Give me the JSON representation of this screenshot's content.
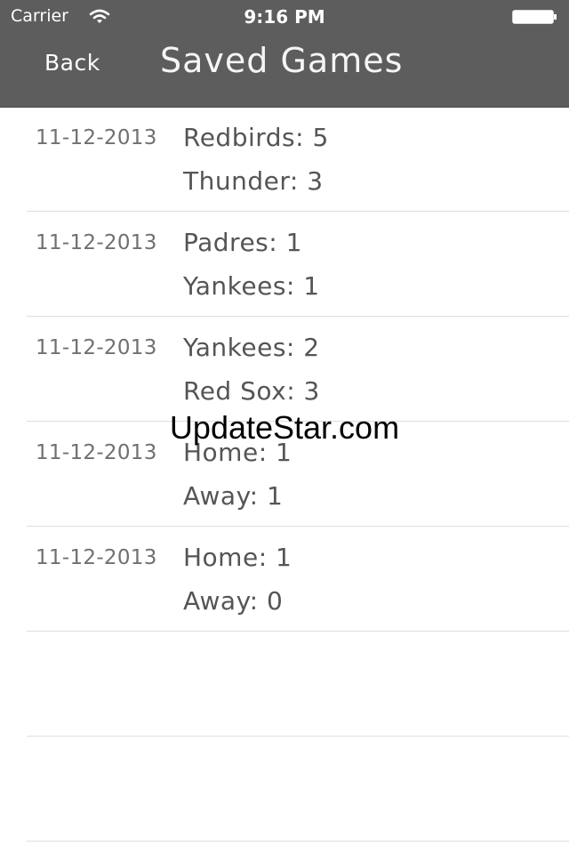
{
  "status_bar": {
    "carrier": "Carrier",
    "time": "9:16 PM",
    "wifi_icon": "wifi-icon",
    "battery_icon": "battery-icon"
  },
  "nav": {
    "back_label": "Back",
    "title": "Saved Games"
  },
  "games": [
    {
      "date": "11-12-2013",
      "line1": "Redbirds: 5",
      "line2": "Thunder: 3"
    },
    {
      "date": "11-12-2013",
      "line1": "Padres: 1",
      "line2": "Yankees: 1"
    },
    {
      "date": "11-12-2013",
      "line1": "Yankees: 2",
      "line2": "Red Sox: 3"
    },
    {
      "date": "11-12-2013",
      "line1": "Home: 1",
      "line2": "Away: 1"
    },
    {
      "date": "11-12-2013",
      "line1": "Home: 1",
      "line2": "Away: 0"
    }
  ],
  "empty_rows": 2,
  "watermark": "UpdateStar.com",
  "colors": {
    "nav_background": "#5d5d5d",
    "separator": "#dedede",
    "date_text": "#707070",
    "score_text": "#555555"
  }
}
